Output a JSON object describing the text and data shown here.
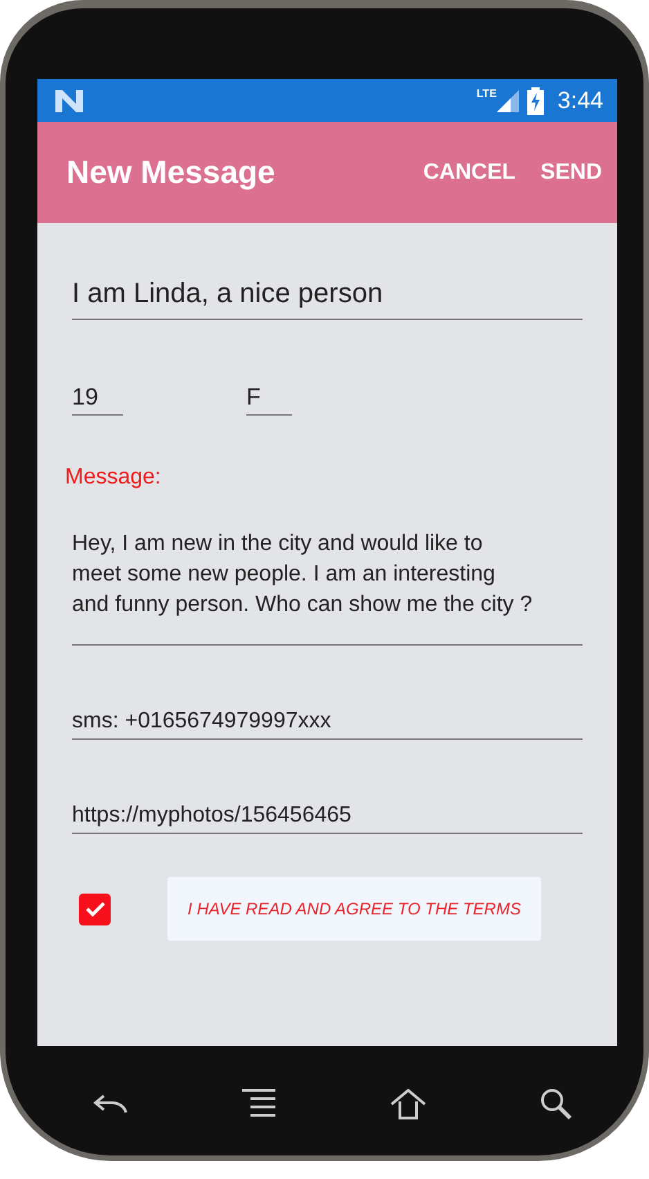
{
  "status_bar": {
    "network": "LTE",
    "time": "3:44"
  },
  "app_bar": {
    "title": "New Message",
    "actions": [
      "CANCEL",
      "SEND"
    ]
  },
  "form": {
    "title_field": {
      "value": "I am Linda, a nice person"
    },
    "age_field": {
      "value": "19"
    },
    "sex_field": {
      "value": "F"
    },
    "message_label": "Message:",
    "message_field": {
      "value": "Hey, I am new in the city and would like to meet some new people. I am an interesting and funny person. Who can show me the city ?"
    },
    "sms_field": {
      "value": "sms: +0165674979997xxx"
    },
    "url_field": {
      "value": "https://myphotos/156456465"
    },
    "terms": {
      "checked": true,
      "label": "I HAVE READ AND AGREE TO THE TERMS"
    }
  },
  "nav_bar": {
    "buttons": [
      {
        "kind": "back"
      },
      {
        "kind": "recents"
      },
      {
        "kind": "home"
      },
      {
        "kind": "search"
      }
    ]
  }
}
